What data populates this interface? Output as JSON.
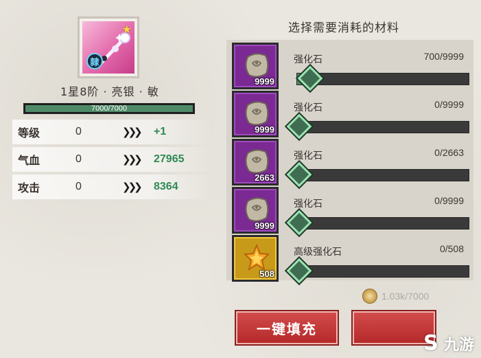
{
  "item": {
    "name": "1星8阶 · 亮银 · 敏",
    "badge": "隸",
    "star": "★",
    "exp_text": "7000/7000",
    "exp_fraction": 1.0
  },
  "stats": [
    {
      "label": "等级",
      "current": "0",
      "next": "+1"
    },
    {
      "label": "气血",
      "current": "0",
      "next": "27965"
    },
    {
      "label": "攻击",
      "current": "0",
      "next": "8364"
    }
  ],
  "arrow_glyph": "❯❯❯",
  "materials": {
    "title": "选择需要消耗的材料",
    "items": [
      {
        "name": "强化石",
        "owned": "9999",
        "count": "700/9999",
        "fraction": 0.07,
        "rarity": "purple"
      },
      {
        "name": "强化石",
        "owned": "9999",
        "count": "0/9999",
        "fraction": 0.0,
        "rarity": "purple"
      },
      {
        "name": "强化石",
        "owned": "2663",
        "count": "0/2663",
        "fraction": 0.0,
        "rarity": "purple"
      },
      {
        "name": "强化石",
        "owned": "9999",
        "count": "0/9999",
        "fraction": 0.0,
        "rarity": "purple"
      },
      {
        "name": "高级强化石",
        "owned": "508",
        "count": "0/508",
        "fraction": 0.0,
        "rarity": "gold"
      }
    ]
  },
  "coin_text": "1.03k/7000",
  "buttons": {
    "fill_label": "一键填充",
    "confirm_label": ""
  },
  "watermark": {
    "logo": "S",
    "text": "九游"
  },
  "colors": {
    "accent_green": "#2f8a55",
    "button_red": "#c23a3a",
    "purple_slot": "#7a2a92",
    "gold_slot": "#c89a1a"
  }
}
